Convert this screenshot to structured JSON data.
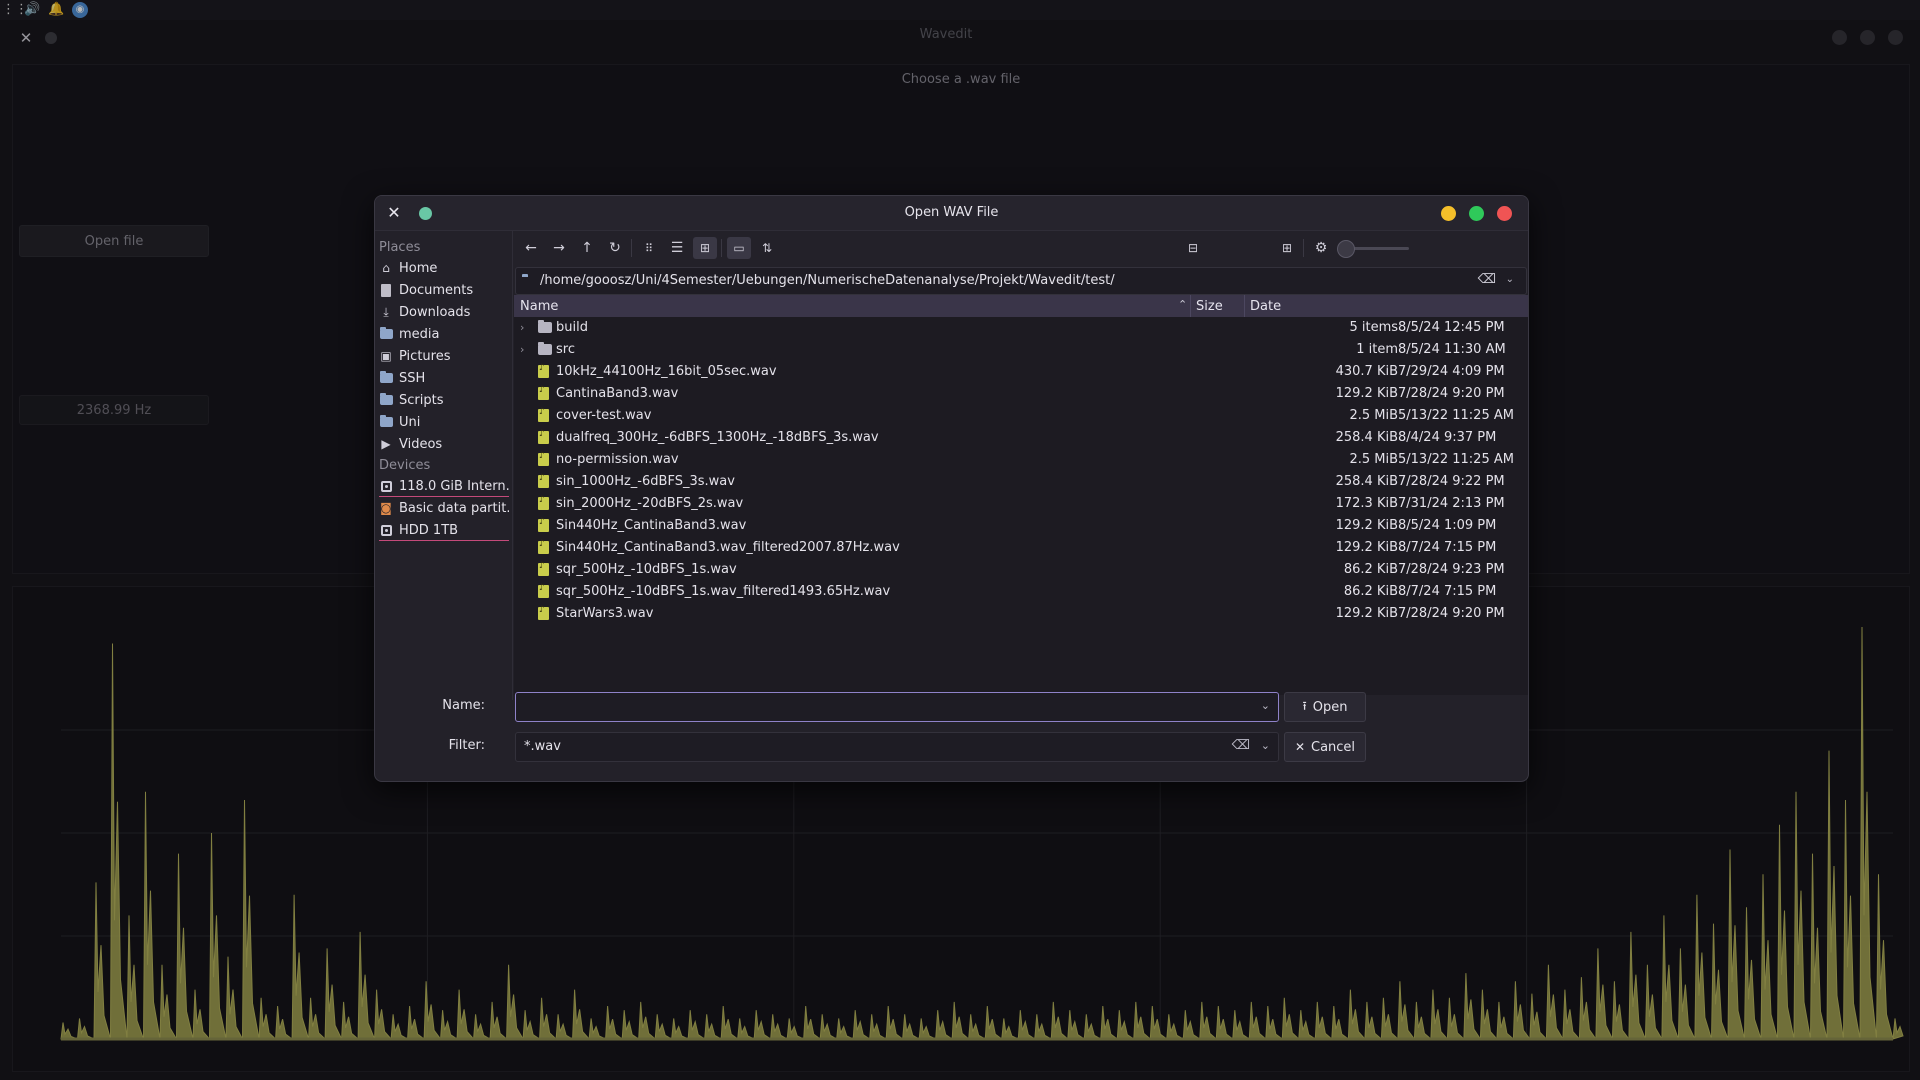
{
  "taskbar": {
    "icons": [
      "apps-grid-icon",
      "volume-icon",
      "bell-icon",
      "browser-icon"
    ]
  },
  "app": {
    "title": "Wavedit",
    "choose_label": "Choose a .wav file",
    "open_file_button": "Open file",
    "frequency_display": "2368.99 Hz"
  },
  "dialog": {
    "title": "Open WAV File",
    "places_label": "Places",
    "places": [
      {
        "label": "Home",
        "icon": "home-icon"
      },
      {
        "label": "Documents",
        "icon": "document-icon"
      },
      {
        "label": "Downloads",
        "icon": "download-icon"
      },
      {
        "label": "media",
        "icon": "folder-icon"
      },
      {
        "label": "Pictures",
        "icon": "picture-icon"
      },
      {
        "label": "SSH",
        "icon": "folder-icon"
      },
      {
        "label": "Scripts",
        "icon": "folder-icon"
      },
      {
        "label": "Uni",
        "icon": "folder-icon"
      },
      {
        "label": "Videos",
        "icon": "video-icon"
      }
    ],
    "devices_label": "Devices",
    "devices": [
      {
        "label": "118.0 GiB Intern...",
        "icon": "drive-icon"
      },
      {
        "label": "Basic data partit...",
        "icon": "partition-icon"
      },
      {
        "label": "HDD 1TB",
        "icon": "drive-icon"
      }
    ],
    "path": "/home/gooosz/Uni/4Semester/Uebungen/NumerischeDatenanalyse/Projekt/Wavedit/test/",
    "columns": {
      "name": "Name",
      "size": "Size",
      "date": "Date"
    },
    "files": [
      {
        "name": "build",
        "size": "5 items",
        "date": "8/5/24 12:45 PM",
        "type": "folder"
      },
      {
        "name": "src",
        "size": "1 item",
        "date": "8/5/24 11:30 AM",
        "type": "folder"
      },
      {
        "name": "10kHz_44100Hz_16bit_05sec.wav",
        "size": "430.7 KiB",
        "date": "7/29/24 4:09 PM",
        "type": "wav"
      },
      {
        "name": "CantinaBand3.wav",
        "size": "129.2 KiB",
        "date": "7/28/24 9:20 PM",
        "type": "wav"
      },
      {
        "name": "cover-test.wav",
        "size": "2.5 MiB",
        "date": "5/13/22 11:25 AM",
        "type": "wav"
      },
      {
        "name": "dualfreq_300Hz_-6dBFS_1300Hz_-18dBFS_3s.wav",
        "size": "258.4 KiB",
        "date": "8/4/24 9:37 PM",
        "type": "wav"
      },
      {
        "name": "no-permission.wav",
        "size": "2.5 MiB",
        "date": "5/13/22 11:25 AM",
        "type": "wav"
      },
      {
        "name": "sin_1000Hz_-6dBFS_3s.wav",
        "size": "258.4 KiB",
        "date": "7/28/24 9:22 PM",
        "type": "wav"
      },
      {
        "name": "sin_2000Hz_-20dBFS_2s.wav",
        "size": "172.3 KiB",
        "date": "7/31/24 2:13 PM",
        "type": "wav"
      },
      {
        "name": "Sin440Hz_CantinaBand3.wav",
        "size": "129.2 KiB",
        "date": "8/5/24 1:09 PM",
        "type": "wav"
      },
      {
        "name": "Sin440Hz_CantinaBand3.wav_filtered2007.87Hz.wav",
        "size": "129.2 KiB",
        "date": "8/7/24 7:15 PM",
        "type": "wav"
      },
      {
        "name": "sqr_500Hz_-10dBFS_1s.wav",
        "size": "86.2 KiB",
        "date": "7/28/24 9:23 PM",
        "type": "wav"
      },
      {
        "name": "sqr_500Hz_-10dBFS_1s.wav_filtered1493.65Hz.wav",
        "size": "86.2 KiB",
        "date": "8/7/24 7:15 PM",
        "type": "wav"
      },
      {
        "name": "StarWars3.wav",
        "size": "129.2 KiB",
        "date": "7/28/24 9:20 PM",
        "type": "wav"
      }
    ],
    "name_label": "Name:",
    "name_value": "",
    "filter_label": "Filter:",
    "filter_value": "*.wav",
    "open_button": "Open",
    "cancel_button": "Cancel"
  },
  "colors": {
    "accent": "#8f82c9",
    "header_bg": "#3a3549",
    "wav_icon": "#c9cd4b",
    "spectrum": "#b3b15a",
    "minimize": "#f4bf2a",
    "maximize": "#2fc95a",
    "close": "#f05454"
  },
  "chart_data": {
    "type": "area",
    "title": "",
    "xlabel": "",
    "ylabel": "",
    "description_series": "frequency spectrum, symmetric with tall peaks near both edges",
    "series": [
      {
        "values": [
          4,
          5,
          38,
          96,
          30,
          60,
          18,
          45,
          12,
          50,
          20,
          58,
          10,
          8,
          35,
          10,
          22,
          9,
          26,
          12,
          6,
          8,
          14,
          7,
          12,
          6,
          9,
          18,
          7,
          10,
          6,
          12,
          5,
          8,
          7,
          9,
          6,
          5,
          7,
          6,
          8,
          5,
          7,
          6,
          5,
          8,
          6,
          5,
          7,
          6,
          8,
          6,
          5,
          7,
          9,
          6,
          8,
          5,
          7,
          6,
          9,
          7,
          6,
          8,
          7,
          9,
          8,
          6,
          7,
          9,
          8,
          7,
          9,
          8,
          10,
          7,
          9,
          8,
          12,
          9,
          10,
          14,
          9,
          12,
          10,
          16,
          12,
          9,
          14,
          11,
          18,
          12,
          15,
          22,
          14,
          26,
          18,
          30,
          22,
          35,
          28,
          46,
          32,
          40,
          52,
          60,
          45,
          70,
          58,
          100,
          40,
          5
        ]
      }
    ]
  }
}
